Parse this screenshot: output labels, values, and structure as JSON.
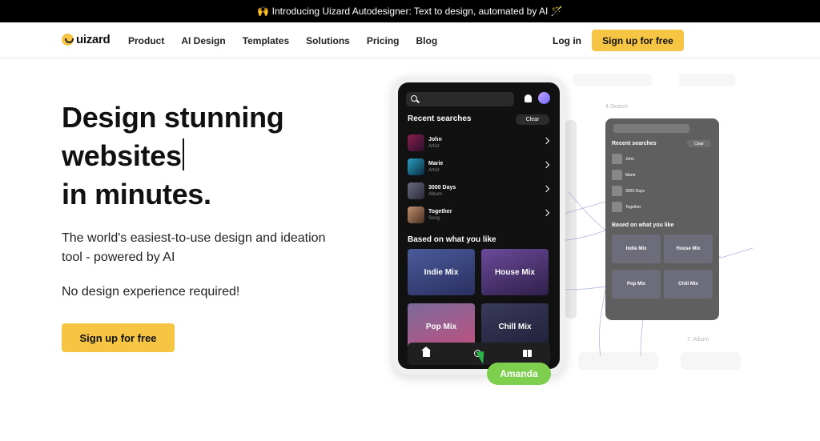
{
  "announcement": {
    "text": "🙌 Introducing Uizard Autodesigner: Text to design, automated by AI 🪄"
  },
  "nav": {
    "logo": "uizard",
    "links": [
      "Product",
      "AI Design",
      "Templates",
      "Solutions",
      "Pricing",
      "Blog"
    ],
    "login": "Log in",
    "signup": "Sign up for free"
  },
  "hero": {
    "headline_line1": "Design stunning",
    "headline_line2": "websites",
    "headline_line3": "in minutes.",
    "subtitle": "The world's easiest-to-use design and ideation tool - powered by AI",
    "subtitle2": "No design experience required!",
    "cta": "Sign up for free"
  },
  "phone": {
    "recent_title": "Recent searches",
    "clear": "Clear",
    "recents": [
      {
        "title": "John",
        "sub": "Artist",
        "color": "#5a1f3a"
      },
      {
        "title": "Marie",
        "sub": "Artist",
        "color": "#1f4a5a"
      },
      {
        "title": "3000 Days",
        "sub": "Album",
        "color": "#3a3a4a"
      },
      {
        "title": "Together",
        "sub": "Song",
        "color": "#6a5a4a"
      }
    ],
    "based_title": "Based on what you like",
    "tiles": [
      "Indie Mix",
      "House Mix",
      "Pop Mix",
      "Chill Mix"
    ],
    "cursor_label": "Amanda"
  },
  "preview": {
    "screen_label_top": "4.Search",
    "screen_label_bottom": "7. Album",
    "recent_title": "Recent searches",
    "clear": "Clear",
    "recents": [
      "John",
      "Marie",
      "3000 Days",
      "Together"
    ],
    "based_title": "Based on what you like",
    "tiles": [
      "Indie Mix",
      "House Mix",
      "Pop Mix",
      "Chill Mix"
    ]
  },
  "colors": {
    "accent": "#f5c543",
    "cursor_green": "#7fcf4e"
  }
}
